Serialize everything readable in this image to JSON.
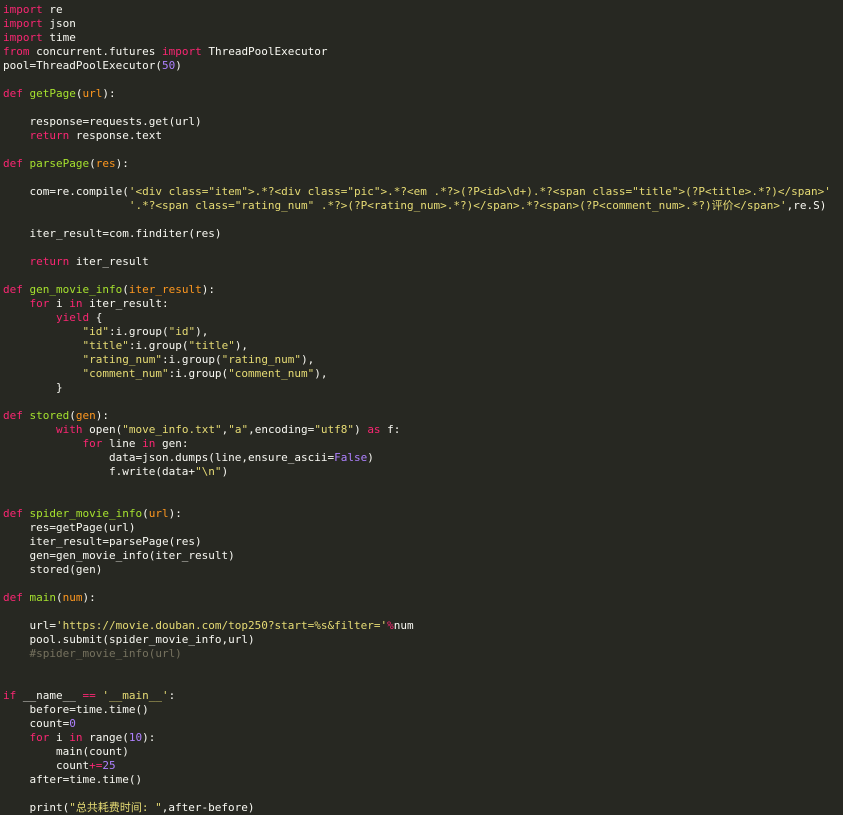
{
  "editor": {
    "lines": [
      [
        [
          "k",
          "import"
        ],
        [
          "t",
          " re"
        ]
      ],
      [
        [
          "k",
          "import"
        ],
        [
          "t",
          " json"
        ]
      ],
      [
        [
          "k",
          "import"
        ],
        [
          "t",
          " time"
        ]
      ],
      [
        [
          "k",
          "from"
        ],
        [
          "t",
          " concurrent.futures "
        ],
        [
          "k",
          "import"
        ],
        [
          "t",
          " ThreadPoolExecutor"
        ]
      ],
      [
        [
          "t",
          "pool=ThreadPoolExecutor("
        ],
        [
          "n",
          "50"
        ],
        [
          "t",
          ")"
        ]
      ],
      [],
      [
        [
          "k",
          "def"
        ],
        [
          "t",
          " "
        ],
        [
          "f",
          "getPage"
        ],
        [
          "t",
          "("
        ],
        [
          "p",
          "url"
        ],
        [
          "t",
          "):"
        ]
      ],
      [],
      [
        [
          "t",
          "    response=requests.get(url)"
        ]
      ],
      [
        [
          "t",
          "    "
        ],
        [
          "k",
          "return"
        ],
        [
          "t",
          " response.text"
        ]
      ],
      [],
      [
        [
          "k",
          "def"
        ],
        [
          "t",
          " "
        ],
        [
          "f",
          "parsePage"
        ],
        [
          "t",
          "("
        ],
        [
          "p",
          "res"
        ],
        [
          "t",
          "):"
        ]
      ],
      [],
      [
        [
          "t",
          "    com=re.compile("
        ],
        [
          "s",
          "'<div class=\"item\">.*?<div class=\"pic\">.*?<em .*?>(?P<id>\\d+).*?<span class=\"title\">(?P<title>.*?)</span>'"
        ]
      ],
      [
        [
          "t",
          "                   "
        ],
        [
          "s",
          "'.*?<span class=\"rating_num\" .*?>(?P<rating_num>.*?)</span>.*?<span>(?P<comment_num>.*?)评价</span>'"
        ],
        [
          "t",
          ",re.S)"
        ]
      ],
      [],
      [
        [
          "t",
          "    iter_result=com.finditer(res)"
        ]
      ],
      [],
      [
        [
          "t",
          "    "
        ],
        [
          "k",
          "return"
        ],
        [
          "t",
          " iter_result"
        ]
      ],
      [],
      [
        [
          "k",
          "def"
        ],
        [
          "t",
          " "
        ],
        [
          "f",
          "gen_movie_info"
        ],
        [
          "t",
          "("
        ],
        [
          "p",
          "iter_result"
        ],
        [
          "t",
          "):"
        ]
      ],
      [
        [
          "t",
          "    "
        ],
        [
          "k",
          "for"
        ],
        [
          "t",
          " i "
        ],
        [
          "k",
          "in"
        ],
        [
          "t",
          " iter_result:"
        ]
      ],
      [
        [
          "t",
          "        "
        ],
        [
          "k",
          "yield"
        ],
        [
          "t",
          " {"
        ]
      ],
      [
        [
          "t",
          "            "
        ],
        [
          "s",
          "\"id\""
        ],
        [
          "t",
          ":i.group("
        ],
        [
          "s",
          "\"id\""
        ],
        [
          "t",
          "),"
        ]
      ],
      [
        [
          "t",
          "            "
        ],
        [
          "s",
          "\"title\""
        ],
        [
          "t",
          ":i.group("
        ],
        [
          "s",
          "\"title\""
        ],
        [
          "t",
          "),"
        ]
      ],
      [
        [
          "t",
          "            "
        ],
        [
          "s",
          "\"rating_num\""
        ],
        [
          "t",
          ":i.group("
        ],
        [
          "s",
          "\"rating_num\""
        ],
        [
          "t",
          "),"
        ]
      ],
      [
        [
          "t",
          "            "
        ],
        [
          "s",
          "\"comment_num\""
        ],
        [
          "t",
          ":i.group("
        ],
        [
          "s",
          "\"comment_num\""
        ],
        [
          "t",
          "),"
        ]
      ],
      [
        [
          "t",
          "        }"
        ]
      ],
      [],
      [
        [
          "k",
          "def"
        ],
        [
          "t",
          " "
        ],
        [
          "f",
          "stored"
        ],
        [
          "t",
          "("
        ],
        [
          "p",
          "gen"
        ],
        [
          "t",
          "):"
        ]
      ],
      [
        [
          "t",
          "        "
        ],
        [
          "k",
          "with"
        ],
        [
          "t",
          " open("
        ],
        [
          "s",
          "\"move_info.txt\""
        ],
        [
          "t",
          ","
        ],
        [
          "s",
          "\"a\""
        ],
        [
          "t",
          ",encoding="
        ],
        [
          "s",
          "\"utf8\""
        ],
        [
          "t",
          ") "
        ],
        [
          "k",
          "as"
        ],
        [
          "t",
          " f:"
        ]
      ],
      [
        [
          "t",
          "            "
        ],
        [
          "k",
          "for"
        ],
        [
          "t",
          " line "
        ],
        [
          "k",
          "in"
        ],
        [
          "t",
          " gen:"
        ]
      ],
      [
        [
          "t",
          "                data=json.dumps(line,ensure_ascii="
        ],
        [
          "n",
          "False"
        ],
        [
          "t",
          ")"
        ]
      ],
      [
        [
          "t",
          "                f.write(data+"
        ],
        [
          "s",
          "\"\\n\""
        ],
        [
          "t",
          ")"
        ]
      ],
      [],
      [],
      [
        [
          "k",
          "def"
        ],
        [
          "t",
          " "
        ],
        [
          "f",
          "spider_movie_info"
        ],
        [
          "t",
          "("
        ],
        [
          "p",
          "url"
        ],
        [
          "t",
          "):"
        ]
      ],
      [
        [
          "t",
          "    res=getPage(url)"
        ]
      ],
      [
        [
          "t",
          "    iter_result=parsePage(res)"
        ]
      ],
      [
        [
          "t",
          "    gen=gen_movie_info(iter_result)"
        ]
      ],
      [
        [
          "t",
          "    stored(gen)"
        ]
      ],
      [],
      [
        [
          "k",
          "def"
        ],
        [
          "t",
          " "
        ],
        [
          "f",
          "main"
        ],
        [
          "t",
          "("
        ],
        [
          "p",
          "num"
        ],
        [
          "t",
          "):"
        ]
      ],
      [],
      [
        [
          "t",
          "    url="
        ],
        [
          "s",
          "'https://movie.douban.com/top250?start=%s&filter='"
        ],
        [
          "k",
          "%"
        ],
        [
          "t",
          "num"
        ]
      ],
      [
        [
          "t",
          "    pool.submit(spider_movie_info,url)"
        ]
      ],
      [
        [
          "c",
          "    #spider_movie_info(url)"
        ]
      ],
      [],
      [],
      [
        [
          "k",
          "if"
        ],
        [
          "t",
          " __name__ "
        ],
        [
          "k",
          "=="
        ],
        [
          "t",
          " "
        ],
        [
          "s",
          "'__main__'"
        ],
        [
          "t",
          ":"
        ]
      ],
      [
        [
          "t",
          "    before=time.time()"
        ]
      ],
      [
        [
          "t",
          "    count="
        ],
        [
          "n",
          "0"
        ]
      ],
      [
        [
          "t",
          "    "
        ],
        [
          "k",
          "for"
        ],
        [
          "t",
          " i "
        ],
        [
          "k",
          "in"
        ],
        [
          "t",
          " range("
        ],
        [
          "n",
          "10"
        ],
        [
          "t",
          "):"
        ]
      ],
      [
        [
          "t",
          "        main(count)"
        ]
      ],
      [
        [
          "t",
          "        count"
        ],
        [
          "k",
          "+="
        ],
        [
          "n",
          "25"
        ]
      ],
      [
        [
          "t",
          "    after=time.time()"
        ]
      ],
      [],
      [
        [
          "t",
          "    print("
        ],
        [
          "s",
          "\"总共耗费时间: \""
        ],
        [
          "t",
          ",after-before)"
        ]
      ]
    ]
  }
}
